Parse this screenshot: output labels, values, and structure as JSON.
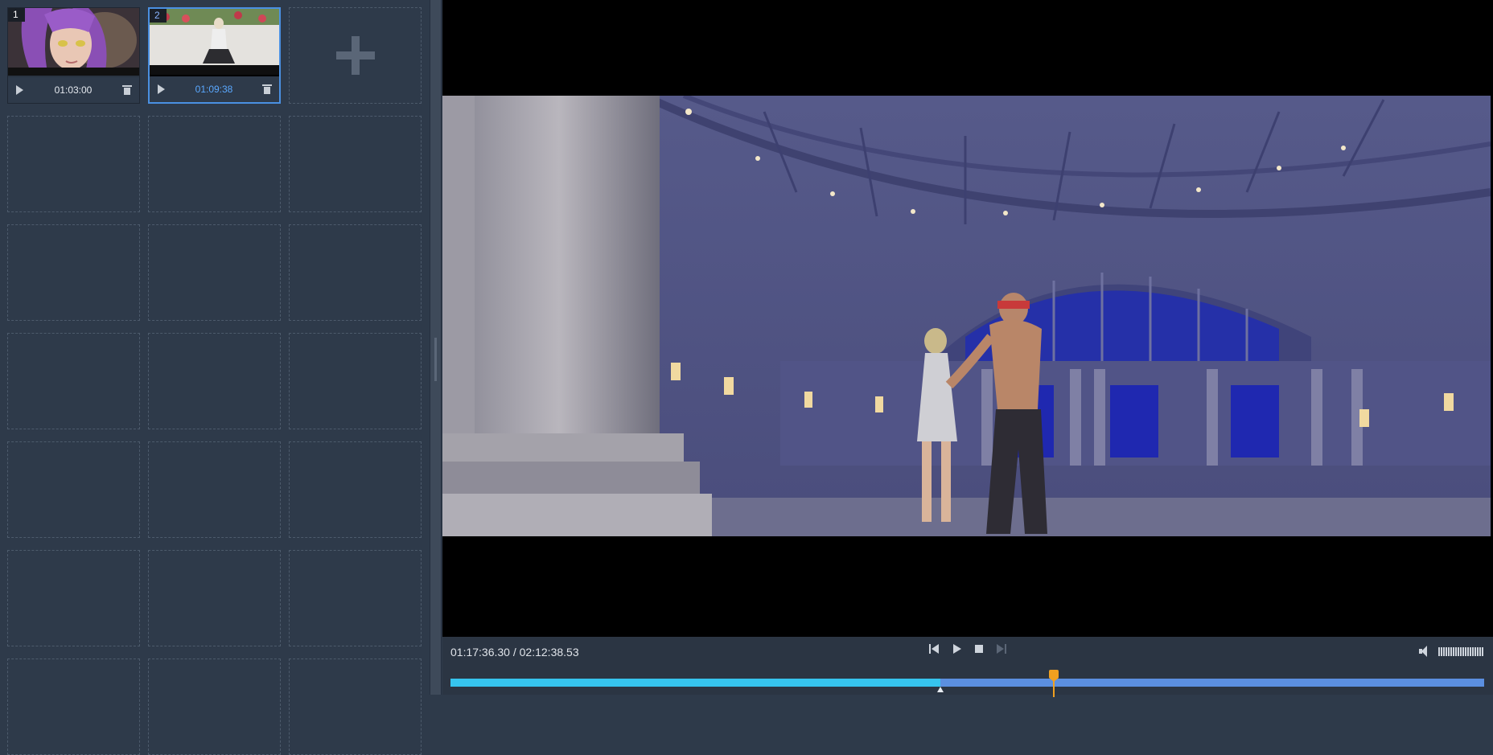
{
  "clips": [
    {
      "number": "1",
      "duration": "01:03:00",
      "selected": false
    },
    {
      "number": "2",
      "duration": "01:09:38",
      "selected": true
    }
  ],
  "player": {
    "current_time": "01:17:36.30",
    "total_time": "02:12:38.53",
    "time_separator": " / ",
    "progress_fraction": 0.474,
    "marker_fraction": 0.584
  },
  "icons": {
    "play": "play-icon",
    "delete": "trash-icon",
    "add": "plus-icon",
    "volume": "speaker-icon"
  },
  "colors": {
    "accent": "#4a90e2",
    "progress_played": "#36c4ee",
    "progress_remaining": "#5b8fe0",
    "marker": "#f0a020"
  }
}
